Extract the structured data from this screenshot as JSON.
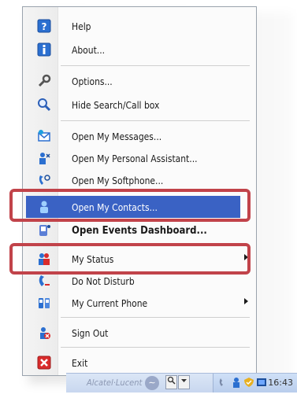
{
  "menu": {
    "items": [
      {
        "label": "Help",
        "icon": "help-icon"
      },
      {
        "label": "About...",
        "icon": "info-icon"
      },
      {
        "label": "Options...",
        "icon": "wrench-icon"
      },
      {
        "label": "Hide Search/Call box",
        "icon": "magnifier-icon"
      },
      {
        "label": "Open My Messages...",
        "icon": "messages-icon"
      },
      {
        "label": "Open My Personal Assistant...",
        "icon": "personal-assistant-icon"
      },
      {
        "label": "Open My Softphone...",
        "icon": "softphone-icon"
      },
      {
        "label": "Open My Contacts...",
        "icon": "contacts-icon",
        "selected": true
      },
      {
        "label": "Open Events Dashboard...",
        "icon": "events-dashboard-icon",
        "bold": true
      },
      {
        "label": "My Status",
        "icon": "status-icon",
        "submenu": true
      },
      {
        "label": "Do Not Disturb",
        "icon": "do-not-disturb-icon"
      },
      {
        "label": "My Current Phone",
        "icon": "phone-icon",
        "submenu": true
      },
      {
        "label": "Sign Out",
        "icon": "sign-out-icon"
      },
      {
        "label": "Exit",
        "icon": "exit-icon"
      }
    ]
  },
  "taskbar": {
    "brand": "Alcatel·Lucent",
    "clock": "16:43"
  },
  "colors": {
    "highlight": "#3a62c4",
    "annotation_frame": "#c1434a"
  }
}
